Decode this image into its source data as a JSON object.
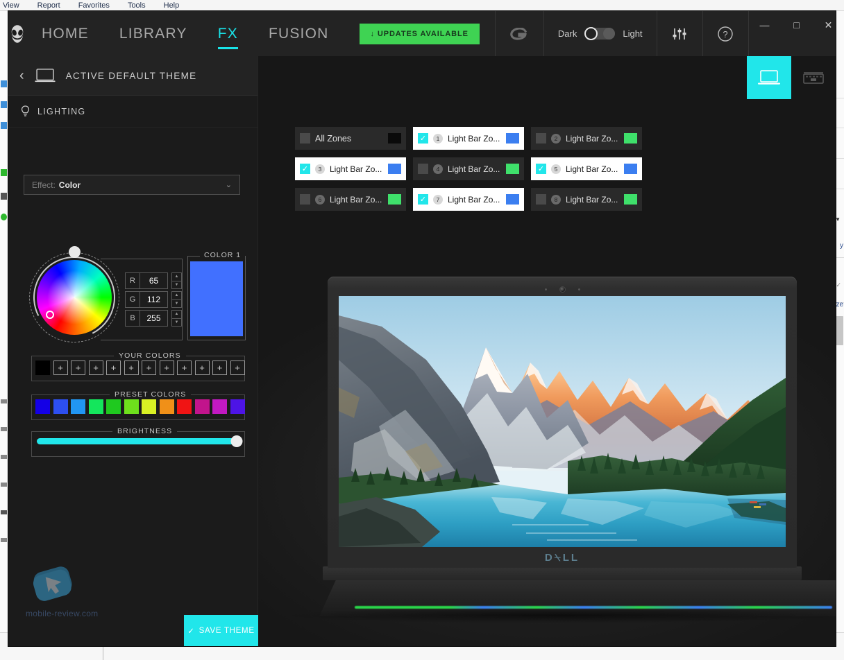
{
  "background_app": {
    "menu_items": [
      "View",
      "Report",
      "Favorites",
      "Tools",
      "Help"
    ],
    "side_text_1": "y",
    "side_text_2": "ze"
  },
  "header": {
    "logo_icon": "alienware-head-icon",
    "nav": [
      {
        "label": "HOME",
        "active": false
      },
      {
        "label": "LIBRARY",
        "active": false
      },
      {
        "label": "FX",
        "active": true
      },
      {
        "label": "FUSION",
        "active": false
      }
    ],
    "updates_button": {
      "label": "UPDATES AVAILABLE",
      "icon": "download-arrow-icon",
      "color": "#3fd353"
    },
    "g_logo": "G",
    "theme_toggle": {
      "left_label": "Dark",
      "right_label": "Light",
      "value": "Dark"
    },
    "settings_icon": "sliders-icon",
    "help_icon": "question-circle-icon",
    "window_controls": {
      "minimize": "—",
      "maximize": "□",
      "close": "✕"
    }
  },
  "sidebar": {
    "back_icon": "chevron-left-icon",
    "device_icon": "laptop-icon",
    "theme_title": "ACTIVE DEFAULT THEME",
    "lighting": {
      "icon": "lightbulb-icon",
      "label": "LIGHTING"
    },
    "effect": {
      "prefix": "Effect:",
      "value": "Color",
      "caret": "chevron-down-icon"
    },
    "rgb": [
      {
        "letter": "R",
        "value": "65"
      },
      {
        "letter": "G",
        "value": "112"
      },
      {
        "letter": "B",
        "value": "255"
      }
    ],
    "color1": {
      "legend": "COLOR 1",
      "hex": "#4170ff"
    },
    "your_colors": {
      "legend": "YOUR COLORS",
      "swatches": [
        "#000000"
      ],
      "empty_slots": 11,
      "add_glyph": "+"
    },
    "preset_colors": {
      "legend": "PRESET COLORS",
      "swatches": [
        "#1400e6",
        "#2d4ff0",
        "#2196f3",
        "#14e65c",
        "#1fc91f",
        "#6ee01c",
        "#d9f024",
        "#f09018",
        "#f01414",
        "#c2148c",
        "#c219c2",
        "#4d14e6"
      ]
    },
    "brightness": {
      "legend": "BRIGHTNESS",
      "value": 100,
      "fill_color": "#21e6ea"
    },
    "watermark": {
      "text": "mobile-review.com",
      "icon": "cursor-arrow-icon"
    },
    "save_button": {
      "label": "SAVE THEME",
      "icon": "check-icon"
    }
  },
  "main": {
    "device_tabs": [
      {
        "name": "laptop-view",
        "icon": "laptop-icon",
        "active": true
      },
      {
        "name": "keyboard-view",
        "icon": "keyboard-icon",
        "active": false
      }
    ],
    "zones": [
      {
        "label": "All Zones",
        "number": "",
        "selected": false,
        "color": "#0a0a0a",
        "all": true
      },
      {
        "label": "Light Bar Zo...",
        "number": "1",
        "selected": true,
        "color": "#3b7ef0"
      },
      {
        "label": "Light Bar Zo...",
        "number": "2",
        "selected": false,
        "color": "#3fe06b"
      },
      {
        "label": "Light Bar Zo...",
        "number": "3",
        "selected": true,
        "color": "#3b7ef0"
      },
      {
        "label": "Light Bar Zo...",
        "number": "4",
        "selected": false,
        "color": "#3fe06b"
      },
      {
        "label": "Light Bar Zo...",
        "number": "5",
        "selected": true,
        "color": "#3b7ef0"
      },
      {
        "label": "Light Bar Zo...",
        "number": "6",
        "selected": false,
        "color": "#3fe06b"
      },
      {
        "label": "Light Bar Zo...",
        "number": "7",
        "selected": true,
        "color": "#3b7ef0"
      },
      {
        "label": "Light Bar Zo...",
        "number": "8",
        "selected": false,
        "color": "#3fe06b"
      }
    ],
    "laptop": {
      "brand": "D⍀LL",
      "wallpaper": "mountain-lake-landscape",
      "light_bar_colors": [
        "#2ad44a",
        "#3b7ef0"
      ]
    }
  }
}
